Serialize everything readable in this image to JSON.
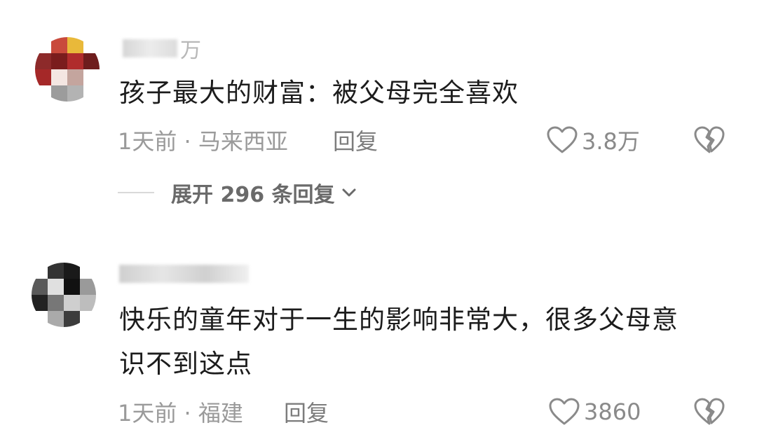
{
  "comments": [
    {
      "username_suffix": "万",
      "text_lines": [
        "孩子最大的财富：被父母完全喜欢"
      ],
      "meta": "1天前 · 马来西亚",
      "reply_label": "回复",
      "likes": "3.8万",
      "expand_label": "展开 296 条回复",
      "avatar_colors": [
        "#ffffff",
        "#c94a3c",
        "#e9b93a",
        "#ffffff",
        "#8d2a2a",
        "#7a1d1d",
        "#b02c2c",
        "#6e1d1d",
        "#a52828",
        "#f4e6e2",
        "#c4a59e",
        "#ffffff",
        "#ffffff",
        "#9c9c9c",
        "#b3b3b3",
        "#ffffff"
      ]
    },
    {
      "username_suffix": "",
      "text_lines": [
        "快乐的童年对于一生的影响非常大，很多父母意",
        "识不到这点"
      ],
      "meta": "1天前 · 福建",
      "reply_label": "回复",
      "likes": "3860",
      "avatar_colors": [
        "#ffffff",
        "#333333",
        "#1a1a1a",
        "#ffffff",
        "#5a5a5a",
        "#e0e0e0",
        "#111111",
        "#9a9a9a",
        "#222222",
        "#777777",
        "#cfcfcf",
        "#bdbdbd",
        "#ffffff",
        "#aaaaaa",
        "#3c3c3c",
        "#ffffff"
      ]
    }
  ]
}
